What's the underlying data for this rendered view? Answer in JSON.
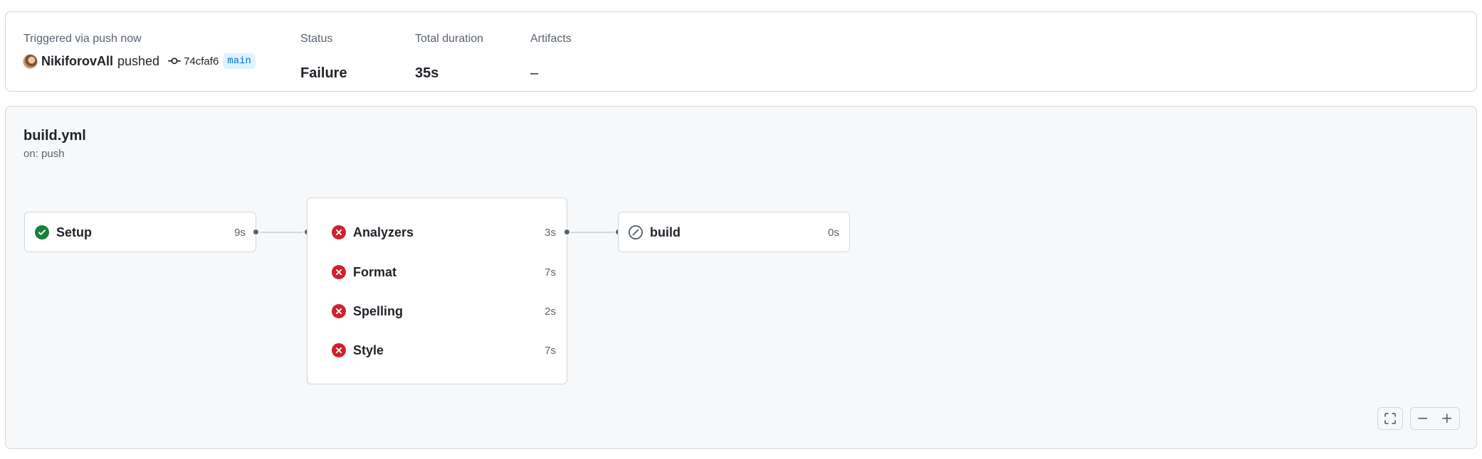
{
  "summary": {
    "trigger_label": "Triggered via push now",
    "actor": "NikiforovAll",
    "action": "pushed",
    "commit_sha": "74cfaf6",
    "branch": "main",
    "status_label": "Status",
    "status_value": "Failure",
    "duration_label": "Total duration",
    "duration_value": "35s",
    "artifacts_label": "Artifacts",
    "artifacts_value": "–"
  },
  "workflow": {
    "file": "build.yml",
    "trigger": "on: push"
  },
  "jobs": {
    "setup": {
      "name": "Setup",
      "duration": "9s",
      "status": "success"
    },
    "analyzers": {
      "name": "Analyzers",
      "duration": "3s",
      "status": "failure"
    },
    "format": {
      "name": "Format",
      "duration": "7s",
      "status": "failure"
    },
    "spelling": {
      "name": "Spelling",
      "duration": "2s",
      "status": "failure"
    },
    "style": {
      "name": "Style",
      "duration": "7s",
      "status": "failure"
    },
    "build": {
      "name": "build",
      "duration": "0s",
      "status": "skipped"
    }
  },
  "icons": {
    "success": "check-circle-fill-icon",
    "failure": "x-circle-fill-icon",
    "skipped": "skip-icon",
    "commit": "git-commit-icon",
    "fullscreen": "screen-full-icon",
    "zoom_out": "dash-icon",
    "zoom_in": "plus-icon"
  },
  "colors": {
    "success": "#1a7f37",
    "failure": "#cf222e",
    "skipped": "#59636e",
    "branch_bg": "#ddf4ff",
    "branch_fg": "#0969da"
  }
}
